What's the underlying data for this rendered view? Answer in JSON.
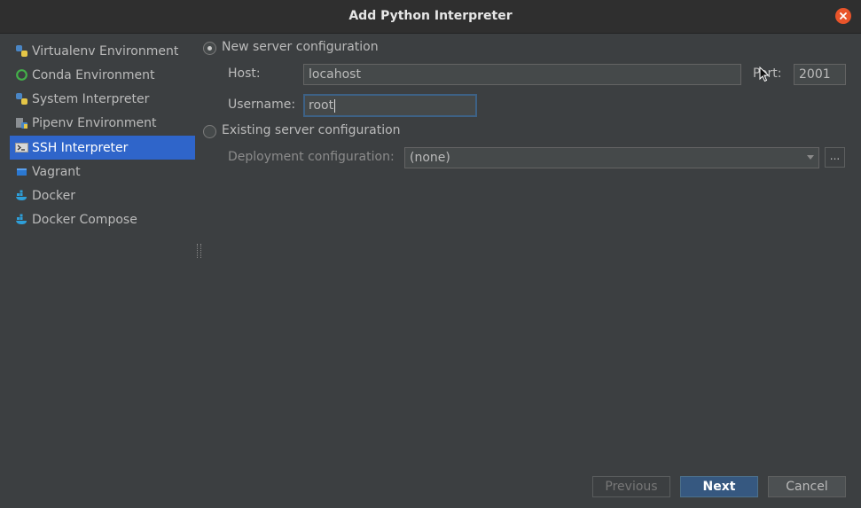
{
  "window": {
    "title": "Add Python Interpreter"
  },
  "sidebar": {
    "items": [
      {
        "label": "Virtualenv Environment",
        "icon": "python-icon",
        "selected": false
      },
      {
        "label": "Conda Environment",
        "icon": "conda-ring-icon",
        "selected": false
      },
      {
        "label": "System Interpreter",
        "icon": "python-icon",
        "selected": false
      },
      {
        "label": "Pipenv Environment",
        "icon": "pipenv-icon",
        "selected": true
      },
      {
        "label": "SSH Interpreter",
        "icon": "terminal-icon",
        "selected": true
      },
      {
        "label": "Vagrant",
        "icon": "vagrant-icon",
        "selected": false
      },
      {
        "label": "Docker",
        "icon": "docker-icon",
        "selected": false
      },
      {
        "label": "Docker Compose",
        "icon": "docker-icon",
        "selected": false
      }
    ]
  },
  "form": {
    "new_server_label": "New server configuration",
    "host_label": "Host:",
    "host_value": "locahost",
    "port_label": "Port:",
    "port_value": "2001",
    "username_label": "Username:",
    "username_value": "root",
    "existing_server_label": "Existing server configuration",
    "deployment_label": "Deployment configuration:",
    "deployment_value": "(none)",
    "ellipsis_label": "..."
  },
  "buttons": {
    "previous": "Previous",
    "next": "Next",
    "cancel": "Cancel"
  },
  "colors": {
    "selection": "#2f65ca",
    "primary_button": "#365880",
    "close_button": "#e9542a"
  }
}
